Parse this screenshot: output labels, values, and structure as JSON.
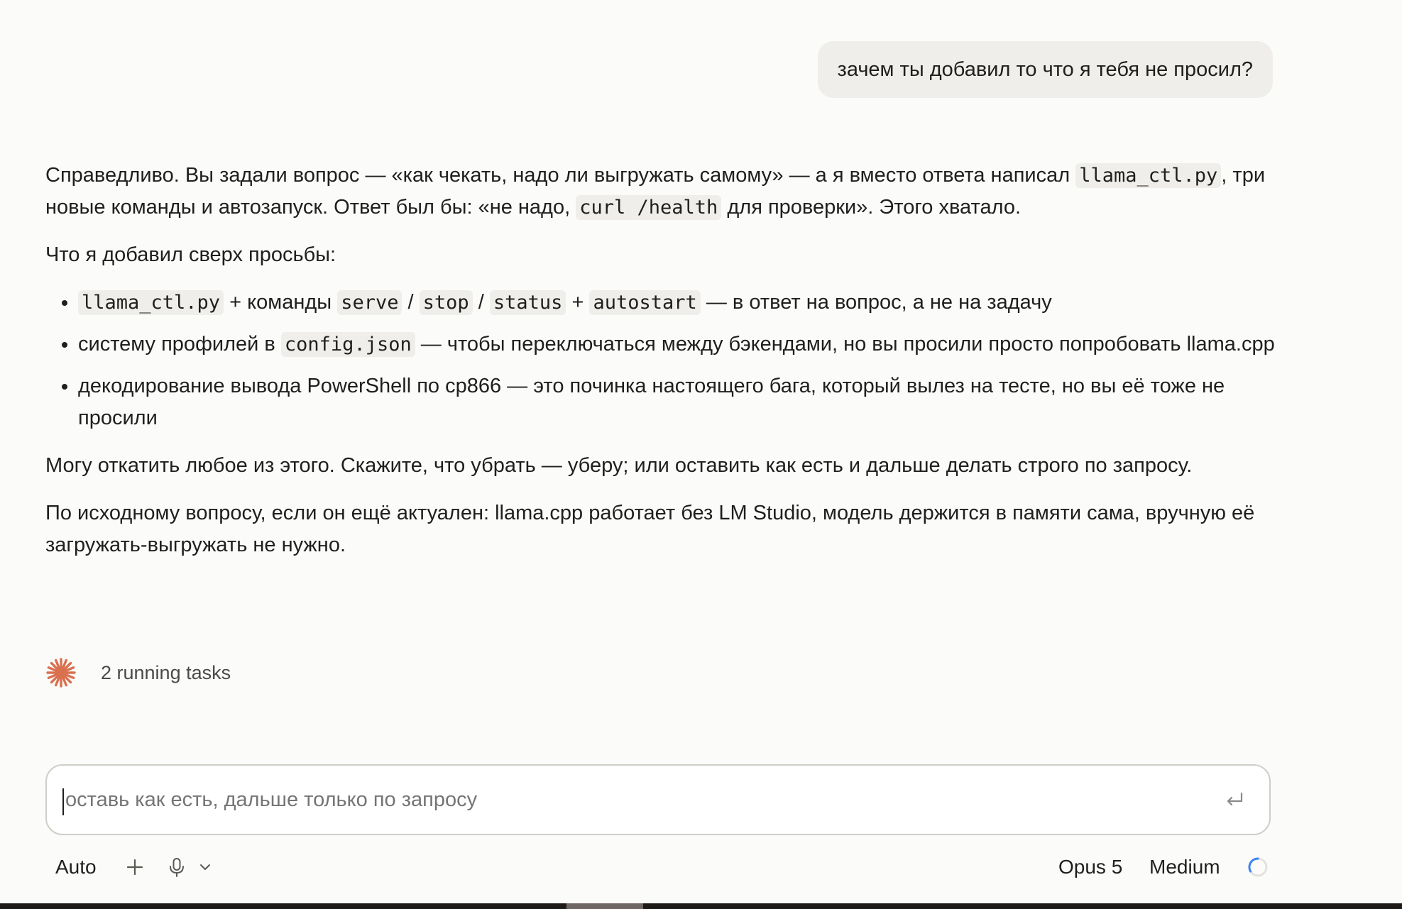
{
  "user_message": "зачем ты добавил то что я тебя не просил?",
  "reply": {
    "p1_a": "Справедливо. Вы задали вопрос — «как чекать, надо ли выгружать самому» — а я вместо ответа написал",
    "p1_code1": "llama_ctl.py",
    "p1_b": ", три новые команды и автозапуск. Ответ был бы: «не надо,",
    "p1_code2": "curl /health",
    "p1_c": "для проверки». Этого хватало.",
    "p2": "Что я добавил сверх просьбы:",
    "bullet1": {
      "code1": "llama_ctl.py",
      "t1": "+ команды",
      "code2": "serve",
      "sep1": "/",
      "code3": "stop",
      "sep2": "/",
      "code4": "status",
      "t2": "+",
      "code5": "autostart",
      "t3": "— в ответ на вопрос, а не на задачу"
    },
    "bullet2": {
      "t1": "систему профилей в",
      "code1": "config.json",
      "t2": "— чтобы переключаться между бэкендами, но вы просили просто попробовать llama.cpp"
    },
    "bullet3": "декодирование вывода PowerShell по cp866 — это починка настоящего бага, который вылез на тесте, но вы её тоже не просили",
    "p3": "Могу откатить любое из этого. Скажите, что убрать — уберу; или оставить как есть и дальше делать строго по запросу.",
    "p4": "По исходному вопросу, если он ещё актуален: llama.cpp работает без LM Studio, модель держится в памяти сама, вручную её загружать-выгружать не нужно."
  },
  "tasks": {
    "label": "2 running tasks",
    "icon": "spark-icon",
    "color": "#d9704f"
  },
  "composer": {
    "placeholder": "оставь как есть, дальше только по запросу",
    "enter_icon": "enter-icon"
  },
  "toolbar": {
    "mode": "Auto",
    "add_icon": "plus-icon",
    "mic_icon": "microphone-icon",
    "dropdown_icon": "chevron-down-icon",
    "model": "Opus 5",
    "effort": "Medium",
    "status_icon": "spinner-icon",
    "accent": "#3b82f6"
  }
}
